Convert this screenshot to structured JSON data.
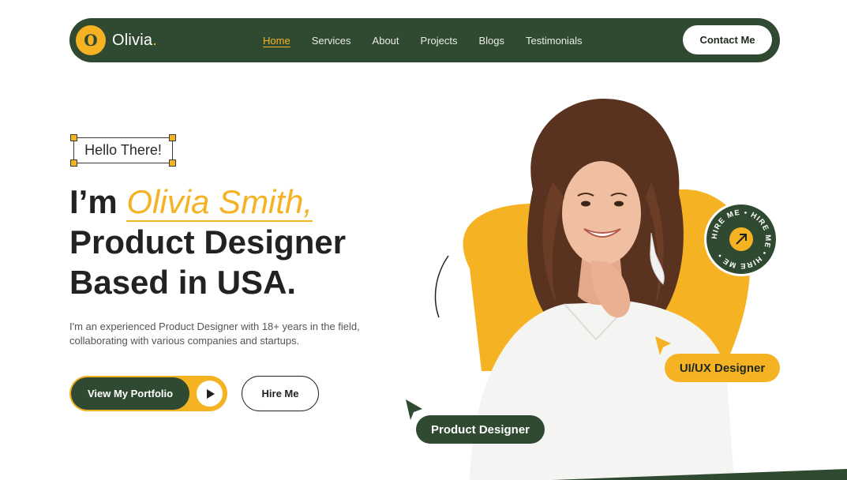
{
  "brand": {
    "initial": "O",
    "name": "Olivia",
    "dot": "."
  },
  "nav": {
    "links": [
      "Home",
      "Services",
      "About",
      "Projects",
      "Blogs",
      "Testimonials"
    ],
    "active": "Home",
    "contact_label": "Contact Me"
  },
  "hero": {
    "greeting": "Hello There!",
    "headline_prefix": "I’m",
    "headline_name": "Olivia Smith,",
    "headline_line2": "Product Designer",
    "headline_line3": "Based in USA.",
    "description": "I'm an experienced Product Designer with 18+ years in the field, collaborating with various companies and startups.",
    "portfolio_label": "View My Portfolio",
    "hire_label": "Hire Me",
    "badge_text": "HIRE ME • HIRE ME • HIRE ME •",
    "tag_uiux": "UI/UX Designer",
    "tag_product": "Product Designer"
  },
  "colors": {
    "accent": "#f5b223",
    "brand_green": "#2f4a30"
  },
  "icons": {
    "play": "play-icon",
    "arrow": "arrow-up-right-icon",
    "cursor": "cursor-arrow-icon"
  }
}
